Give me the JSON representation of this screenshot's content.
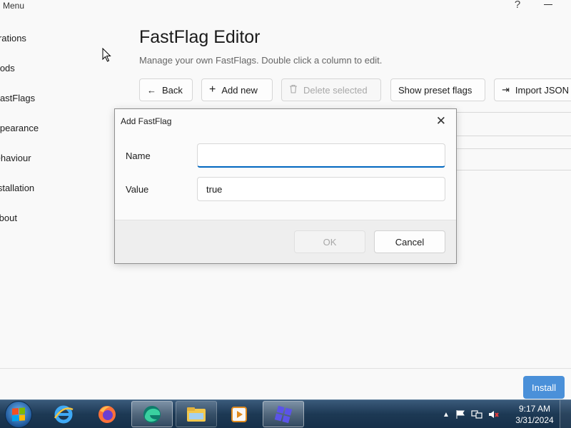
{
  "app": {
    "menu_label": "Menu",
    "help_glyph": "?",
    "sidebar": {
      "items": [
        {
          "label": "Integrations"
        },
        {
          "label": "Mods"
        },
        {
          "label": "FastFlags"
        },
        {
          "label": "Appearance"
        },
        {
          "label": "Behaviour"
        },
        {
          "label": "Installation"
        },
        {
          "label": "About"
        }
      ]
    },
    "page": {
      "title": "FastFlag Editor",
      "subtitle": "Manage your own FastFlags. Double click a column to edit."
    },
    "toolbar": {
      "back_label": "Back",
      "add_new_label": "Add new",
      "delete_selected_label": "Delete selected",
      "show_preset_label": "Show preset flags",
      "import_json_label": "Import JSON"
    },
    "footer": {
      "install_label": "Install"
    }
  },
  "dialog": {
    "title": "Add FastFlag",
    "name_label": "Name",
    "name_value": "",
    "value_label": "Value",
    "value_value": "true",
    "ok_label": "OK",
    "cancel_label": "Cancel"
  },
  "taskbar": {
    "apps": [
      "internet-explorer",
      "firefox",
      "edge",
      "file-explorer",
      "media-player",
      "roblox-studio"
    ],
    "clock_time": "9:17 AM",
    "clock_date": "3/31/2024"
  },
  "colors": {
    "accent": "#0067c0",
    "install_button": "#4a90d9",
    "taskbar": "#1d3954"
  }
}
